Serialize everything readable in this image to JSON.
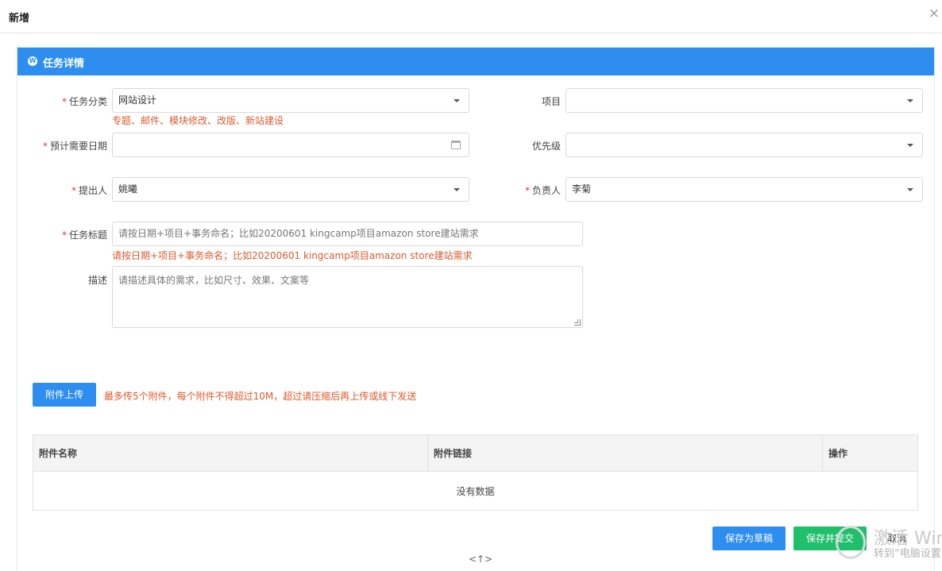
{
  "dialog": {
    "title": "新增",
    "close_label": "×"
  },
  "panel": {
    "title": "任务详情",
    "icon": "wordpress-icon"
  },
  "form": {
    "task_category": {
      "label": "任务分类",
      "required": "*",
      "value": "网站设计",
      "hint": "专题、邮件、模块修改、改版、新站建设"
    },
    "project": {
      "label": "项目",
      "value": ""
    },
    "expected_date": {
      "label": "预计需要日期",
      "required": "*",
      "value": ""
    },
    "priority": {
      "label": "优先级",
      "value": ""
    },
    "proposer": {
      "label": "提出人",
      "required": "*",
      "value": "姚曦"
    },
    "owner": {
      "label": "负责人",
      "required": "*",
      "value": "李菊"
    },
    "task_title": {
      "label": "任务标题",
      "required": "*",
      "placeholder": "请按日期+项目+事务命名；比如20200601 kingcamp项目amazon store建站需求",
      "hint": "请按日期+项目+事务命名；比如20200601 kingcamp项目amazon store建站需求"
    },
    "description": {
      "label": "描述",
      "placeholder": "请描述具体的需求，比如尺寸、效果、文案等"
    }
  },
  "upload": {
    "button_label": "附件上传",
    "hint": "最多传5个附件，每个附件不得超过10M，超过请压缩后再上传或线下发送"
  },
  "attachments_table": {
    "columns": [
      "附件名称",
      "附件链接",
      "操作"
    ],
    "empty_text": "没有数据"
  },
  "footer": {
    "save_draft_label": "保存为草稿",
    "save_submit_label": "保存并提交",
    "cancel_label": "取消"
  },
  "watermark": {
    "line1": "激活 Win",
    "line2": "转到“电脑设置"
  },
  "bottom_handle": "<↑>"
}
